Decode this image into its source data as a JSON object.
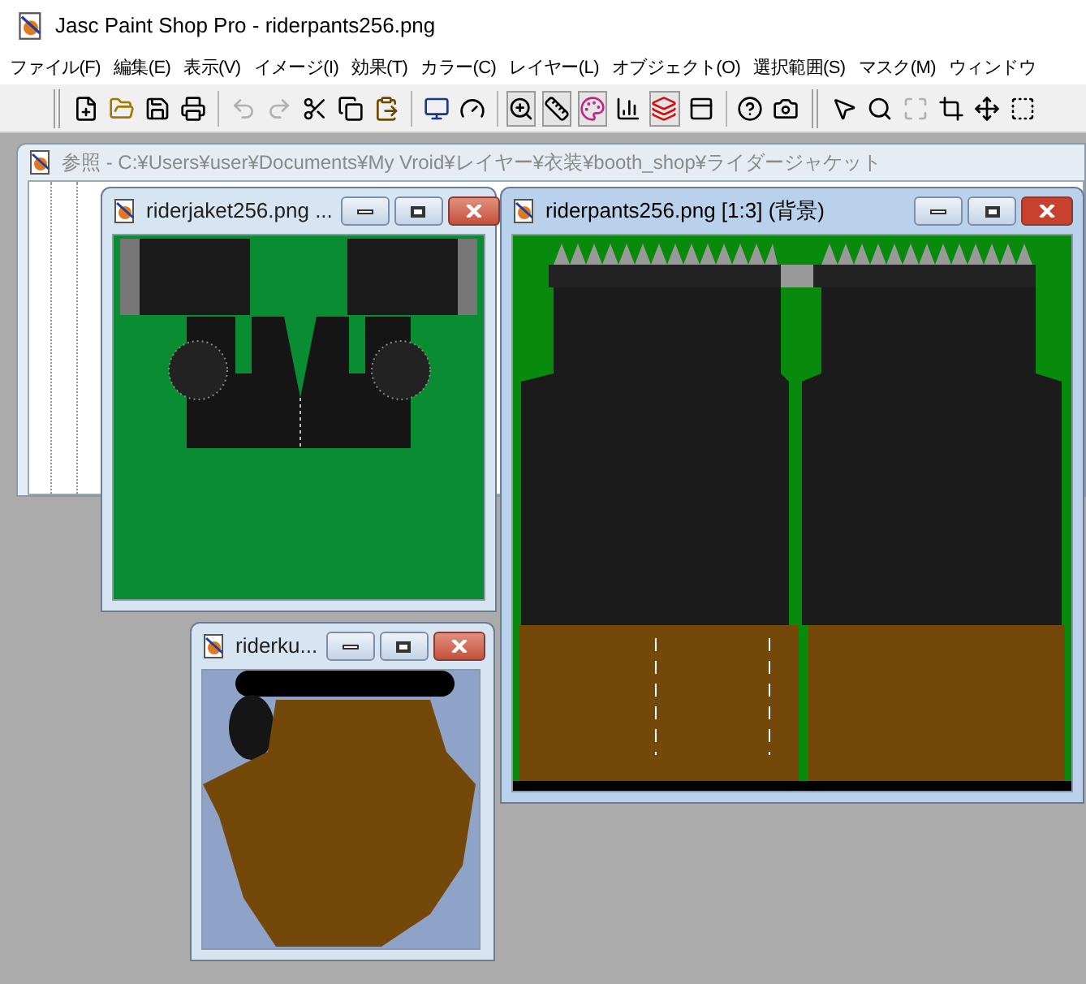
{
  "window": {
    "title": "Jasc Paint Shop Pro - riderpants256.png"
  },
  "menu": [
    "ファイル(F)",
    "編集(E)",
    "表示(V)",
    "イメージ(I)",
    "効果(T)",
    "カラー(C)",
    "レイヤー(L)",
    "オブジェクト(O)",
    "選択範囲(S)",
    "マスク(M)",
    "ウィンドウ"
  ],
  "toolbar": [
    {
      "kind": "grip"
    },
    {
      "kind": "new",
      "disabled": false,
      "pressed": false
    },
    {
      "kind": "open",
      "disabled": false,
      "pressed": false
    },
    {
      "kind": "save",
      "disabled": false,
      "pressed": false
    },
    {
      "kind": "print",
      "disabled": false,
      "pressed": false
    },
    {
      "kind": "sep"
    },
    {
      "kind": "undo",
      "disabled": true,
      "pressed": false
    },
    {
      "kind": "redo",
      "disabled": true,
      "pressed": false
    },
    {
      "kind": "cut",
      "disabled": false,
      "pressed": false
    },
    {
      "kind": "copy",
      "disabled": false,
      "pressed": false
    },
    {
      "kind": "paste",
      "disabled": false,
      "pressed": false
    },
    {
      "kind": "sep"
    },
    {
      "kind": "monitor",
      "disabled": false,
      "pressed": false
    },
    {
      "kind": "gauge",
      "disabled": false,
      "pressed": false
    },
    {
      "kind": "sep"
    },
    {
      "kind": "zoom",
      "disabled": false,
      "pressed": true
    },
    {
      "kind": "ruler",
      "disabled": false,
      "pressed": true
    },
    {
      "kind": "palette",
      "disabled": false,
      "pressed": true
    },
    {
      "kind": "histogram",
      "disabled": false,
      "pressed": false
    },
    {
      "kind": "layers",
      "disabled": false,
      "pressed": true
    },
    {
      "kind": "panel",
      "disabled": false,
      "pressed": false
    },
    {
      "kind": "sep"
    },
    {
      "kind": "help",
      "disabled": false,
      "pressed": false
    },
    {
      "kind": "camera",
      "disabled": false,
      "pressed": false
    },
    {
      "kind": "grip"
    },
    {
      "kind": "pointer",
      "disabled": false,
      "pressed": false
    },
    {
      "kind": "search",
      "disabled": false,
      "pressed": false
    },
    {
      "kind": "deform",
      "disabled": true,
      "pressed": false
    },
    {
      "kind": "crop",
      "disabled": false,
      "pressed": false
    },
    {
      "kind": "move",
      "disabled": false,
      "pressed": false
    },
    {
      "kind": "select",
      "disabled": false,
      "pressed": false
    }
  ],
  "browser": {
    "title": "参照 - C:¥Users¥user¥Documents¥My Vroid¥レイヤー¥衣装¥booth_shop¥ライダージャケット",
    "active": false
  },
  "documents": [
    {
      "title": "riderjaket256.png ...",
      "active": false,
      "kind": "jacket"
    },
    {
      "title": "riderku...",
      "active": false,
      "kind": "hair"
    },
    {
      "title": "riderpants256.png [1:3] (背景)",
      "active": true,
      "kind": "pants"
    }
  ]
}
